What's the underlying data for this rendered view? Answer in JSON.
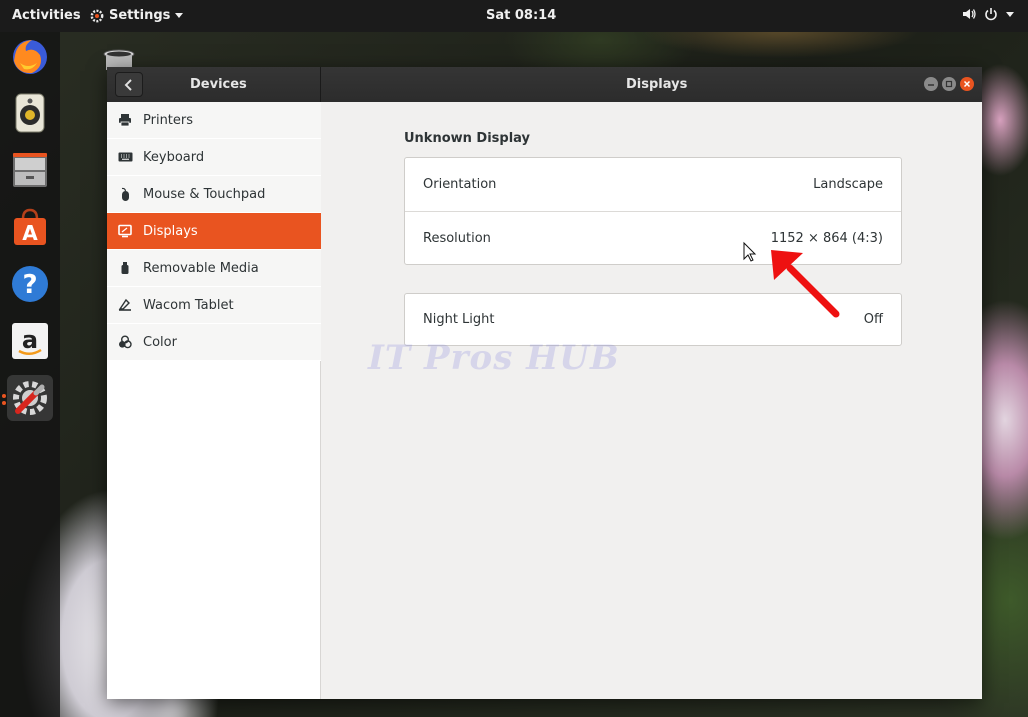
{
  "topbar": {
    "activities": "Activities",
    "app_menu": "Settings",
    "clock": "Sat 08:14"
  },
  "dock": {
    "items": [
      {
        "name": "firefox",
        "icon": "firefox-icon"
      },
      {
        "name": "rhythmbox",
        "icon": "speaker-icon"
      },
      {
        "name": "files",
        "icon": "file-cabinet-icon"
      },
      {
        "name": "software",
        "icon": "shopping-bag-icon"
      },
      {
        "name": "help",
        "icon": "question-icon"
      },
      {
        "name": "amazon",
        "icon": "amazon-icon"
      },
      {
        "name": "settings",
        "icon": "wrench-icon"
      }
    ]
  },
  "window": {
    "sidebar_title": "Devices",
    "panel_title": "Displays",
    "sidebar_items": [
      {
        "label": "Printers",
        "icon": "printer-icon"
      },
      {
        "label": "Keyboard",
        "icon": "keyboard-icon"
      },
      {
        "label": "Mouse & Touchpad",
        "icon": "mouse-icon"
      },
      {
        "label": "Displays",
        "icon": "display-icon",
        "selected": true
      },
      {
        "label": "Removable Media",
        "icon": "usb-drive-icon"
      },
      {
        "label": "Wacom Tablet",
        "icon": "tablet-icon"
      },
      {
        "label": "Color",
        "icon": "color-icon"
      }
    ],
    "display_section": {
      "title": "Unknown Display",
      "rows": [
        {
          "label": "Orientation",
          "value": "Landscape"
        },
        {
          "label": "Resolution",
          "value": "1152 × 864 (4:3)"
        }
      ]
    },
    "night_light": {
      "label": "Night Light",
      "value": "Off"
    }
  },
  "watermark": "IT Pros HUB",
  "colors": {
    "accent": "#e95420",
    "headerbar": "#2c2c2c",
    "annotation_arrow": "#ee1111"
  }
}
